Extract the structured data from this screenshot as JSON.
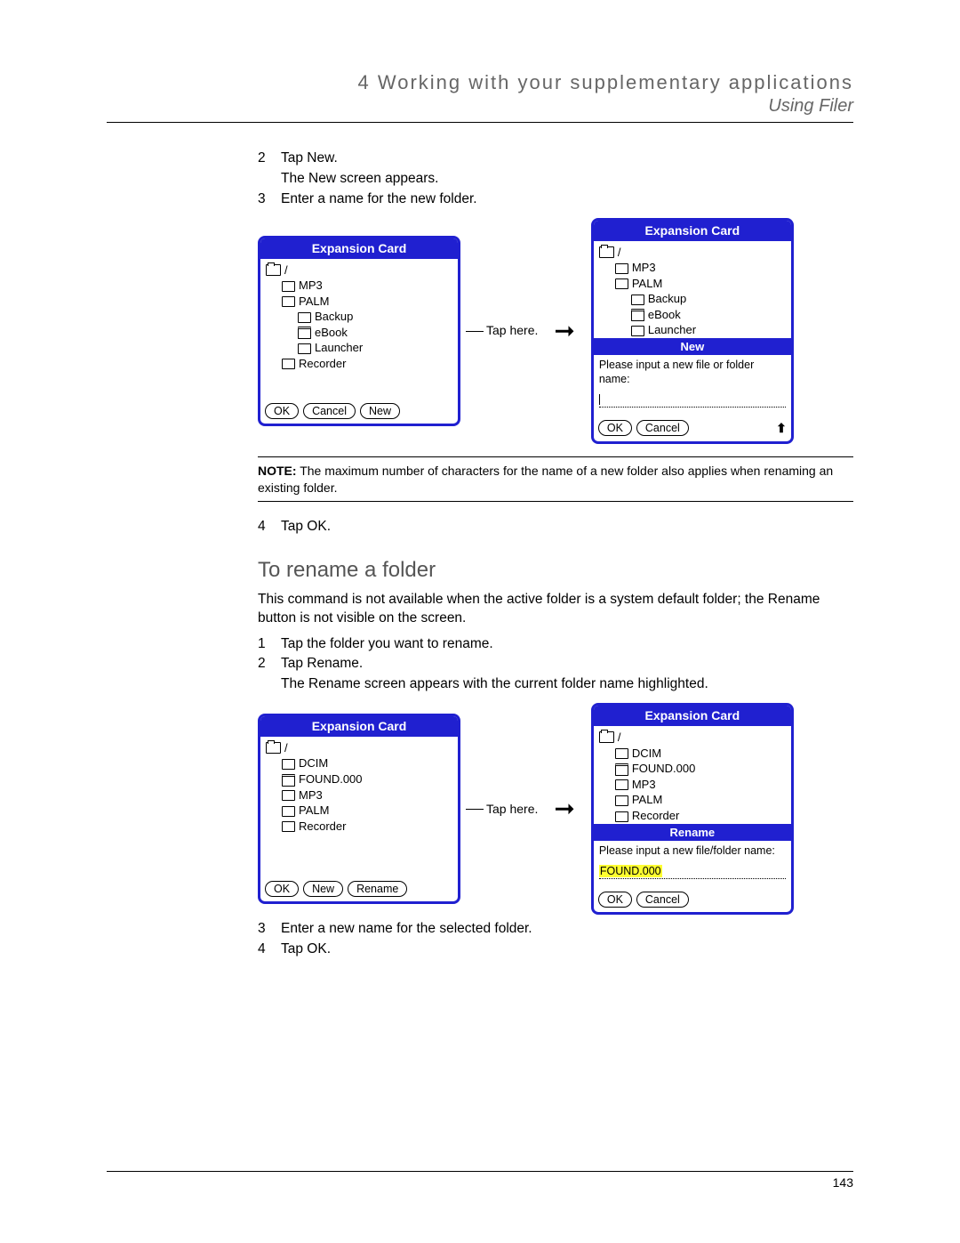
{
  "header": {
    "chapter": "4 Working with your supplementary applications",
    "section": "Using Filer"
  },
  "steps_top": {
    "s2": "Tap New.",
    "s2_sub": "The New screen appears.",
    "s3": "Enter a name for the new folder."
  },
  "palm_common": {
    "title": "Expansion Card",
    "root": "/",
    "ok": "OK",
    "cancel": "Cancel",
    "new": "New",
    "rename": "Rename"
  },
  "fig1": {
    "items": [
      "MP3",
      "PALM",
      "Backup",
      "eBook",
      "Launcher",
      "Recorder"
    ],
    "callout": "Tap here.",
    "sub_title": "New",
    "prompt": "Please input a new file or folder name:",
    "items_b": [
      "MP3",
      "PALM",
      "Backup",
      "eBook",
      "Launcher"
    ]
  },
  "note": {
    "label": "NOTE:",
    "text": " The maximum number of characters for the name of a new folder also applies when renaming an existing folder."
  },
  "step4": "Tap OK.",
  "section2": {
    "title": "To rename a folder",
    "intro": "This command is not available when the active folder is a system default folder; the Rename button is not visible on the screen.",
    "s1": "Tap the folder you want to rename.",
    "s2": "Tap Rename.",
    "s2_sub": "The Rename screen appears with the current folder name highlighted.",
    "s3": "Enter a new name for the selected folder.",
    "s4": "Tap OK."
  },
  "fig2": {
    "items": [
      "DCIM",
      "FOUND.000",
      "MP3",
      "PALM",
      "Recorder"
    ],
    "callout": "Tap here.",
    "sub_title": "Rename",
    "prompt": "Please input a new file/folder name:",
    "highlight": "FOUND.000"
  },
  "page_number": "143"
}
